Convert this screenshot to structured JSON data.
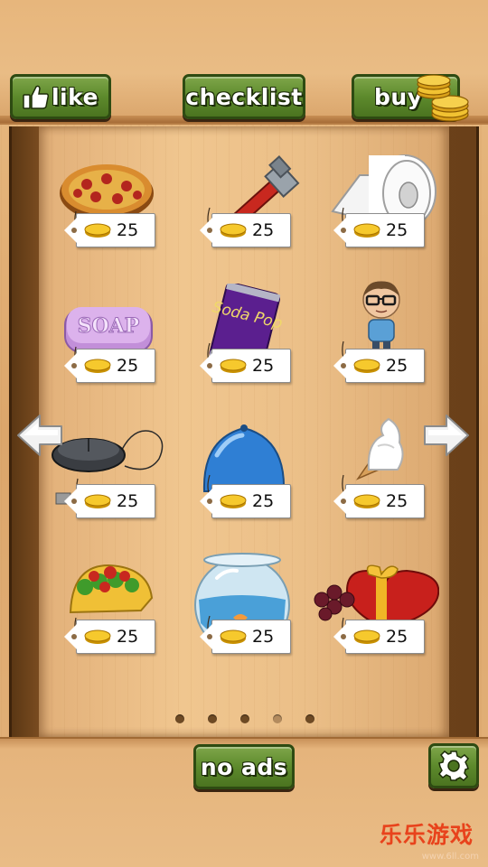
{
  "top_bar": {
    "like_label": "like",
    "checklist_label": "checklist",
    "buy_label": "buy"
  },
  "items": [
    {
      "name": "pizza",
      "price": "25"
    },
    {
      "name": "pipe wrench",
      "price": "25"
    },
    {
      "name": "toilet paper",
      "price": "25"
    },
    {
      "name": "soap",
      "price": "25",
      "art_text": "SOAP"
    },
    {
      "name": "soda pop",
      "price": "25",
      "art_text": "Soda Pop"
    },
    {
      "name": "nerd figure",
      "price": "25"
    },
    {
      "name": "computer mouse",
      "price": "25"
    },
    {
      "name": "water balloon",
      "price": "25"
    },
    {
      "name": "ice cream cone",
      "price": "25"
    },
    {
      "name": "taco",
      "price": "25"
    },
    {
      "name": "fishbowl",
      "price": "25"
    },
    {
      "name": "heart chocolate box",
      "price": "25"
    }
  ],
  "pagination": {
    "total": 5,
    "active_index": 3
  },
  "bottom_bar": {
    "no_ads_label": "no ads"
  },
  "watermark": {
    "text": "乐乐游戏",
    "url": "www.6ll.com"
  },
  "colors": {
    "button_green": "#5d8a2c",
    "wood_light": "#ebbf88",
    "frame_dark": "#6a4019",
    "coin_gold": "#f1c232"
  },
  "icons": {
    "like": "thumbs-up-icon",
    "buy": "coin-stack-icon",
    "settings": "gear-icon",
    "prev": "arrow-left-icon",
    "next": "arrow-right-icon"
  }
}
